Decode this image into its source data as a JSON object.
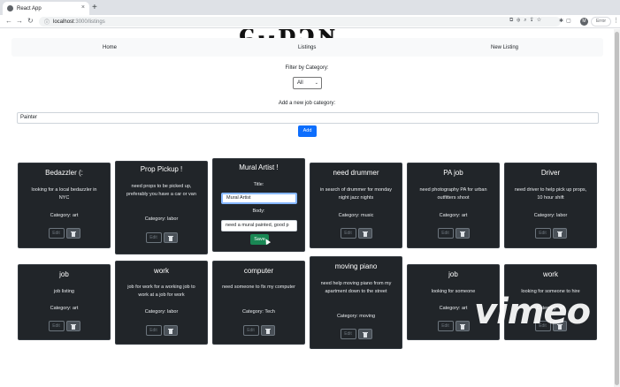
{
  "browser": {
    "tab_title": "React App",
    "new_tab_symbol": "+",
    "close_symbol": "×",
    "url_host": "localhost",
    "url_path": ":3000/listings",
    "error_label": "Error",
    "avatar_letter": "M"
  },
  "nav": {
    "home": "Home",
    "listings": "Listings",
    "new_listing": "New Listing"
  },
  "filter": {
    "label": "Filter by Category:",
    "selected": "All"
  },
  "add_category": {
    "label": "Add a new job category:",
    "value": "Painter",
    "button": "Add"
  },
  "card_labels": {
    "edit": "Edit"
  },
  "editing": {
    "title_label": "Title:",
    "body_label": "Body:",
    "title_value": "Mural Artist",
    "body_value": "need a mural painted, good p",
    "save": "Save"
  },
  "listings": [
    {
      "title": "Bedazzler (:",
      "body": "looking for a local bedazzler in NYC",
      "category": "Category: art"
    },
    {
      "title": "Prop Pickup !",
      "body": "need props to be picked up, preferably you have a car or van",
      "category": "Category: labor"
    },
    {
      "title": "Mural Artist !"
    },
    {
      "title": "need drummer",
      "body": "in search of drummer for monday night jazz nights",
      "category": "Category: music"
    },
    {
      "title": "PA job",
      "body": "need photography PA for urban outfitters shoot",
      "category": "Category: art"
    },
    {
      "title": "Driver",
      "body": "need driver to help pick up props, 10 hour shift",
      "category": "Category: labor"
    },
    {
      "title": "job",
      "body": "job listing",
      "category": "Category: art"
    },
    {
      "title": "work",
      "body": "job for work for a working job to work at a job for work",
      "category": "Category: labor"
    },
    {
      "title": "computer",
      "body": "need someone to fix my computer",
      "category": "Category: Tech"
    },
    {
      "title": "moving piano",
      "body": "need help moving piano from my apartment down to the street",
      "category": "Category: moving"
    },
    {
      "title": "job",
      "body": "looking for someone",
      "category": "Category: art"
    },
    {
      "title": "work",
      "body": "looking for someone to hire",
      "category": "Category: art"
    }
  ],
  "watermark": "vimeo"
}
